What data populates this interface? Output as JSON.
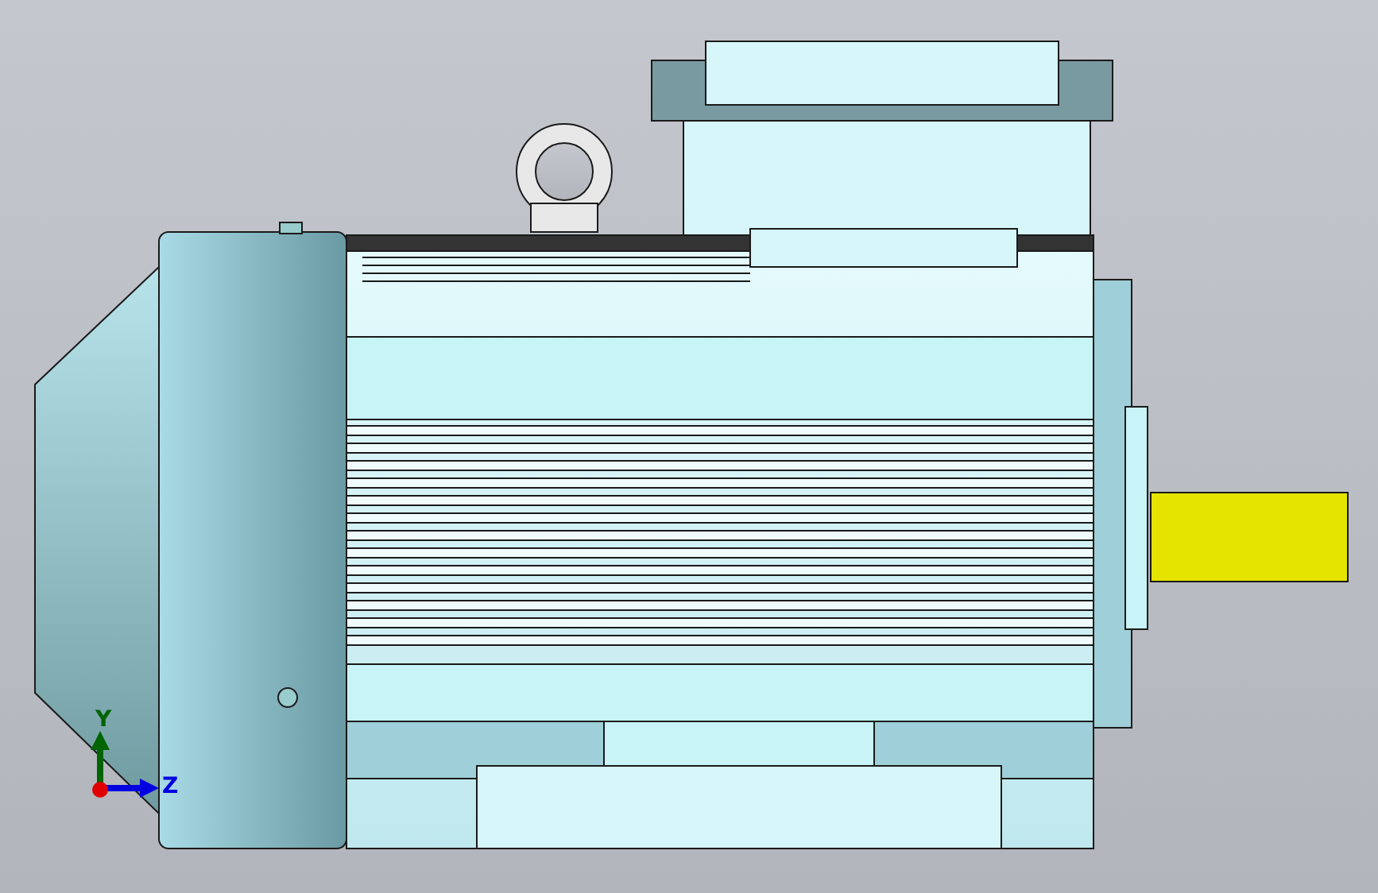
{
  "viewport": {
    "triad": {
      "axes": [
        {
          "label": "Y",
          "color": "#006400"
        },
        {
          "label": "Z",
          "color": "#0000e0"
        }
      ]
    }
  }
}
